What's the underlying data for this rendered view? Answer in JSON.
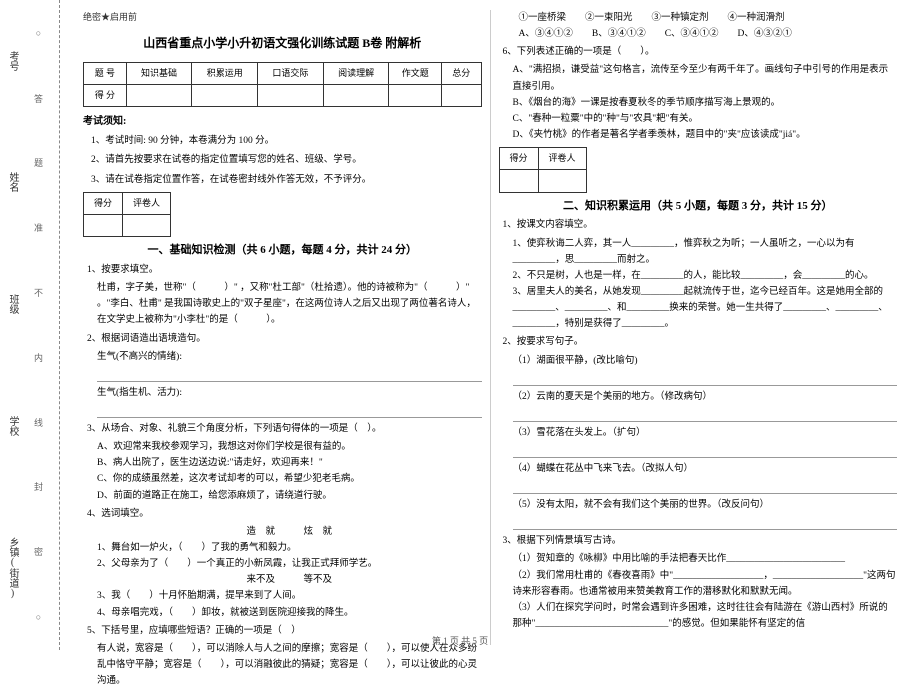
{
  "gutter": {
    "labels": [
      "考号",
      "姓名",
      "班级",
      "学校",
      "乡镇(街道)"
    ],
    "markers": [
      "答",
      "题",
      "准",
      "不",
      "内",
      "线",
      "封",
      "密"
    ],
    "circle": "○"
  },
  "header": {
    "secret": "绝密★启用前",
    "title": "山西省重点小学小升初语文强化训练试题 B卷 附解析"
  },
  "score_table": {
    "row1": [
      "题 号",
      "知识基础",
      "积累运用",
      "口语交际",
      "阅读理解",
      "作文题",
      "总分"
    ],
    "row2": "得 分"
  },
  "notice": {
    "heading": "考试须知:",
    "items": [
      "1、考试时间: 90 分钟，本卷满分为 100 分。",
      "2、请首先按要求在试卷的指定位置填写您的姓名、班级、学号。",
      "3、请在试卷指定位置作答，在试卷密封线外作答无效，不予评分。"
    ]
  },
  "score_box": {
    "c1": "得分",
    "c2": "评卷人"
  },
  "part1": {
    "title": "一、基础知识检测（共 6 小题，每题 4 分，共计 24 分）",
    "q1": {
      "stem": "1、按要求填空。",
      "line1": "杜甫，字子美，世称\"（　　　）\" ，又称\"杜工部\"（杜拾遗）。他的诗被称为\"（　　　）\" 。\"李白、杜甫\" 是我国诗歌史上的\"双子星座\"，在这两位诗人之后又出现了两位著名诗人，在文学史上被称为\"小李杜\"的是（　　　）。"
    },
    "q2": {
      "stem": "2、根据词语造出语境造句。",
      "l1": "生气(不高兴的情绪):",
      "l2": "生气(指生机、活力):"
    },
    "q3": {
      "stem": "3、从场合、对象、礼貌三个角度分析，下列语句得体的一项是（　）。",
      "a": "A、欢迎常来我校参观学习，我想这对你们学校是很有益的。",
      "b": "B、病人出院了，医生边送边说:\"请走好，欢迎再来！\"",
      "c": "C、你的成绩虽然差，这次考试却考的可以，希望少犯老毛病。",
      "d": "D、前面的道路正在施工，给您添麻烦了，请绕道行驶。"
    },
    "q4": {
      "stem": "4、选词填空。",
      "words": "造　就　　　炫　就",
      "l1": "1、舞台如一炉火，（　　）了我的勇气和毅力。",
      "l2": "2、父母亲为了（　　）一个真正的小新凤霞，让我正式拜师学艺。",
      "words2": "来不及　　　等不及",
      "l3": "3、我（　　）十月怀胎期满，提早来到了人间。",
      "l4": "4、母亲唱完戏，（　　）卸妆，就被送到医院迎接我的降生。"
    },
    "q5": {
      "stem": "5、下括号里，应填哪些短语？正确的一项是（　）",
      "text": "有人说，宽容是（　　），可以消除人与人之间的摩擦；宽容是（　　），可以使人在众多纷乱中恪守平静；宽容是（　　），可以消融彼此的猜疑；宽容是（　　），可以让彼此的心灵沟通。"
    }
  },
  "part1_right": {
    "opts": "①一座桥梁　　②一束阳光　　③一种镇定剂　　④一种润滑剂",
    "choices": "A、③④①②　　B、③④①②　　C、③④①②　　D、④③②①"
  },
  "q6": {
    "stem": "6、下列表述正确的一项是（　　）。",
    "a": "A、\"满招损，谦受益\"这句格言，流传至今至少有两千年了。画线句子中引号的作用是表示直接引用。",
    "b": "B、《烟台的海》一课是按春夏秋冬的季节顺序描写海上景观的。",
    "c": "C、\"春种一粒粟\"中的\"种\"与\"农具\"耙\"有关。",
    "d": "D、《夹竹桃》的作者是著名学者季羡林，题目中的\"夹\"应该读成\"jiá\"。"
  },
  "part2": {
    "title": "二、知识积累运用（共 5 小题，每题 3 分，共计 15 分）",
    "q1": {
      "stem": "1、按课文内容填空。",
      "l1": "1、使弈秋诲二人弈，其一人_________，惟弈秋之为听；一人虽听之，一心以为有_________，思_________而射之。",
      "l2": "2、不只是树，人也是一样，在_________的人，能比较_________，会_________的心。",
      "l3": "3、居里夫人的美名，从她发现_________起就流传于世，迄今已经百年。这是她用全部的_________、_________、和_________换来的荣誉。她一生共得了_________、_________、_________，特别是获得了_________。"
    },
    "q2": {
      "stem": "2、按要求写句子。",
      "l1": "（1）湖面很平静，(改比喻句)",
      "l2": "（2）云南的夏天是个美丽的地方。（修改病句）",
      "l3": "（3）雪花落在头发上。（扩句）",
      "l4": "（4）蝴蝶在花丛中飞来飞去。（改拟人句）",
      "l5": "（5）没有太阳，就不会有我们这个美丽的世界。（改反问句）"
    },
    "q3": {
      "stem": "3、根据下列情景填写古诗。",
      "l1": "（1）贺知章的《咏柳》中用比喻的手法把春天比作_________________________",
      "l2": "（2）我们常用杜甫的《春夜喜雨》中\"___________________，___________________\"这两句诗来形容春雨。也通常被用来赞美教育工作的潜移默化和默默无闻。",
      "l3": "（3）人们在探究学问时，时常会遇到许多困难，这时往往会有陆游在《游山西村》所说的那种\"____________________________\"的感觉。但如果能怀有坚定的信"
    }
  },
  "footer": "第 1 页  共 5 页"
}
